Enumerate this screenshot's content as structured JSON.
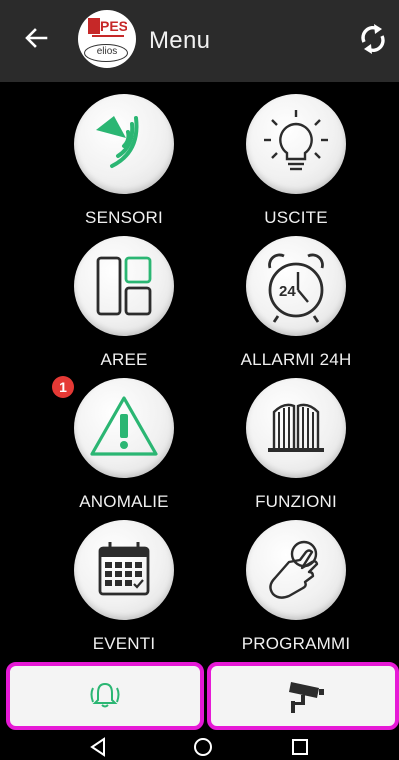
{
  "header": {
    "title": "Menu",
    "logo_text": "PESS",
    "logo_sub": "elios"
  },
  "tiles": [
    {
      "label": "SENSORI",
      "icon": "sensor-icon"
    },
    {
      "label": "USCITE",
      "icon": "lightbulb-icon"
    },
    {
      "label": "AREE",
      "icon": "areas-icon"
    },
    {
      "label": "ALLARMI 24H",
      "icon": "alarm-clock-24h-icon",
      "icon_text": "24"
    },
    {
      "label": "ANOMALIE",
      "icon": "warning-icon",
      "badge": "1"
    },
    {
      "label": "FUNZIONI",
      "icon": "gate-icon"
    },
    {
      "label": "EVENTI",
      "icon": "calendar-icon"
    },
    {
      "label": "PROGRAMMI",
      "icon": "touch-hand-icon"
    }
  ],
  "colors": {
    "accent_green": "#2bb673",
    "highlight_magenta": "#e619d6",
    "badge_red": "#e53935"
  },
  "bottom_bar": [
    {
      "icon": "alarm-bell-icon"
    },
    {
      "icon": "security-camera-icon"
    }
  ]
}
